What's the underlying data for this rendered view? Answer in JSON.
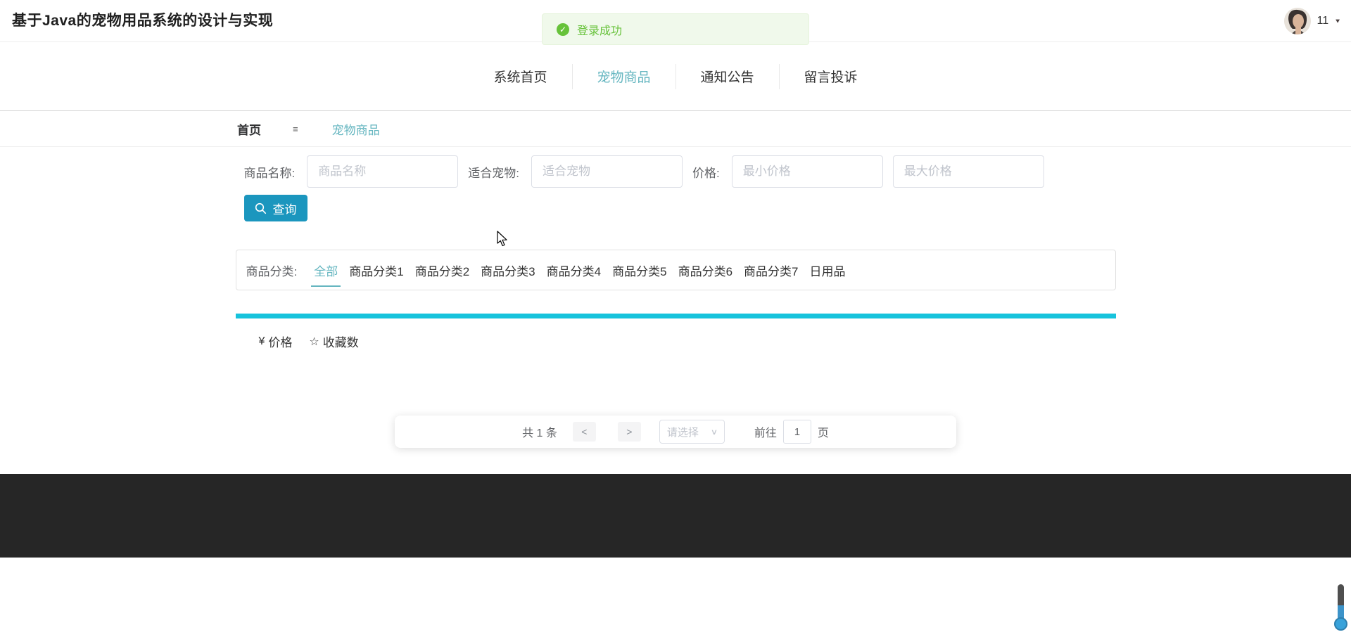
{
  "header": {
    "title": "基于Java的宠物用品系统的设计与实现",
    "user_badge": "11"
  },
  "toast": {
    "message": "登录成功"
  },
  "nav": {
    "items": [
      {
        "label": "系统首页",
        "active": false
      },
      {
        "label": "宠物商品",
        "active": true
      },
      {
        "label": "通知公告",
        "active": false
      },
      {
        "label": "留言投诉",
        "active": false
      }
    ]
  },
  "breadcrumb": {
    "home": "首页",
    "current": "宠物商品"
  },
  "search_form": {
    "name_label": "商品名称:",
    "name_placeholder": "商品名称",
    "pet_label": "适合宠物:",
    "pet_placeholder": "适合宠物",
    "price_label": "价格:",
    "min_price_placeholder": "最小价格",
    "max_price_placeholder": "最大价格",
    "submit_label": "查询"
  },
  "category_filter": {
    "label": "商品分类:",
    "selected": "全部",
    "options": [
      "全部",
      "商品分类1",
      "商品分类2",
      "商品分类3",
      "商品分类4",
      "商品分类5",
      "商品分类6",
      "商品分类7",
      "日用品"
    ]
  },
  "sort_bar": {
    "price_icon": "¥",
    "price_label": "价格",
    "favorites_icon": "☆",
    "favorites_label": "收藏数"
  },
  "pagination": {
    "total_text": "共 1 条",
    "prev_label": "<",
    "next_label": ">",
    "page_size_placeholder": "请选择",
    "goto_prefix": "前往",
    "page_value": "1",
    "goto_suffix": "页"
  },
  "icons": {
    "success_check": "✓",
    "breadcrumb_sep": "≡",
    "user_caret": "▼",
    "select_caret": "∨"
  },
  "colors": {
    "accent_teal": "#65b6c0",
    "button_blue": "#1b96be",
    "divider_cyan": "#17c3dc",
    "success_green": "#67c23a",
    "footer_dark": "#262626"
  }
}
